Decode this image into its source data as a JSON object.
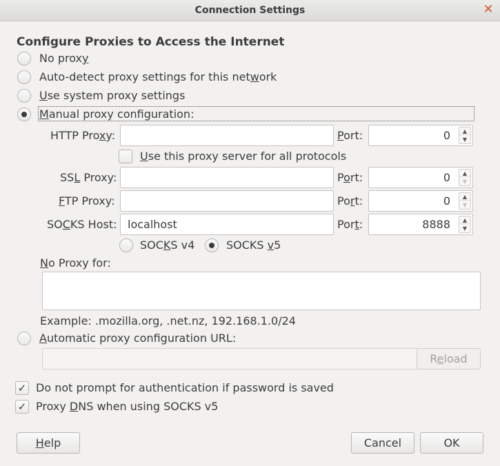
{
  "window": {
    "title": "Connection Settings",
    "close_icon": "close-icon"
  },
  "heading": "Configure Proxies to Access the Internet",
  "proxy_modes": {
    "no_proxy": {
      "pre": "No prox",
      "key": "y",
      "post": ""
    },
    "auto_detect": {
      "pre": "Auto-detect proxy settings for this net",
      "key": "w",
      "post": "ork"
    },
    "system": {
      "pre": "",
      "key": "U",
      "post": "se system proxy settings"
    },
    "manual": {
      "pre": "",
      "key": "M",
      "post": "anual proxy configuration:"
    },
    "selected": "manual"
  },
  "http": {
    "label_pre": "HTTP Pro",
    "label_key": "x",
    "label_post": "y:",
    "value": "",
    "port_pre": "",
    "port_key": "P",
    "port_post": "ort:",
    "port": "0"
  },
  "use_for_all": {
    "pre": "",
    "key": "U",
    "post": "se this proxy server for all protocols",
    "checked": false
  },
  "ssl": {
    "label_pre": "SS",
    "label_key": "L",
    "label_post": " Proxy:",
    "value": "",
    "port_pre": "P",
    "port_key": "o",
    "port_post": "rt:",
    "port": "0"
  },
  "ftp": {
    "label_pre": "",
    "label_key": "F",
    "label_post": "TP Proxy:",
    "value": "",
    "port_pre": "Po",
    "port_key": "r",
    "port_post": "t:",
    "port": "0"
  },
  "socks": {
    "label_pre": "SO",
    "label_key": "C",
    "label_post": "KS Host:",
    "value": "localhost",
    "port_pre": "Por",
    "port_key": "t",
    "port_post": ":",
    "port": "8888"
  },
  "socks_version": {
    "v4": {
      "pre": "SOC",
      "key": "K",
      "post": "S v4"
    },
    "v5": {
      "pre": "SOCKS ",
      "key": "v",
      "post": "5"
    },
    "selected": "v5"
  },
  "no_proxy_for": {
    "pre": "",
    "key": "N",
    "post": "o Proxy for:",
    "value": ""
  },
  "example": "Example: .mozilla.org, .net.nz, 192.168.1.0/24",
  "auto_config": {
    "pre": "",
    "key": "A",
    "post": "utomatic proxy configuration URL:",
    "value": "",
    "reload_pre": "R",
    "reload_key": "e",
    "reload_post": "load"
  },
  "no_prompt_auth": {
    "label": "Do not prompt for authentication if password is saved",
    "checked": true
  },
  "proxy_dns": {
    "pre": "Proxy ",
    "key": "D",
    "post": "NS when using SOCKS v5",
    "checked": true
  },
  "buttons": {
    "help_pre": "",
    "help_key": "H",
    "help_post": "elp",
    "cancel": "Cancel",
    "ok": "OK"
  },
  "colors": {
    "accent_close": "#d8572d",
    "background": "#f2f1f0"
  }
}
